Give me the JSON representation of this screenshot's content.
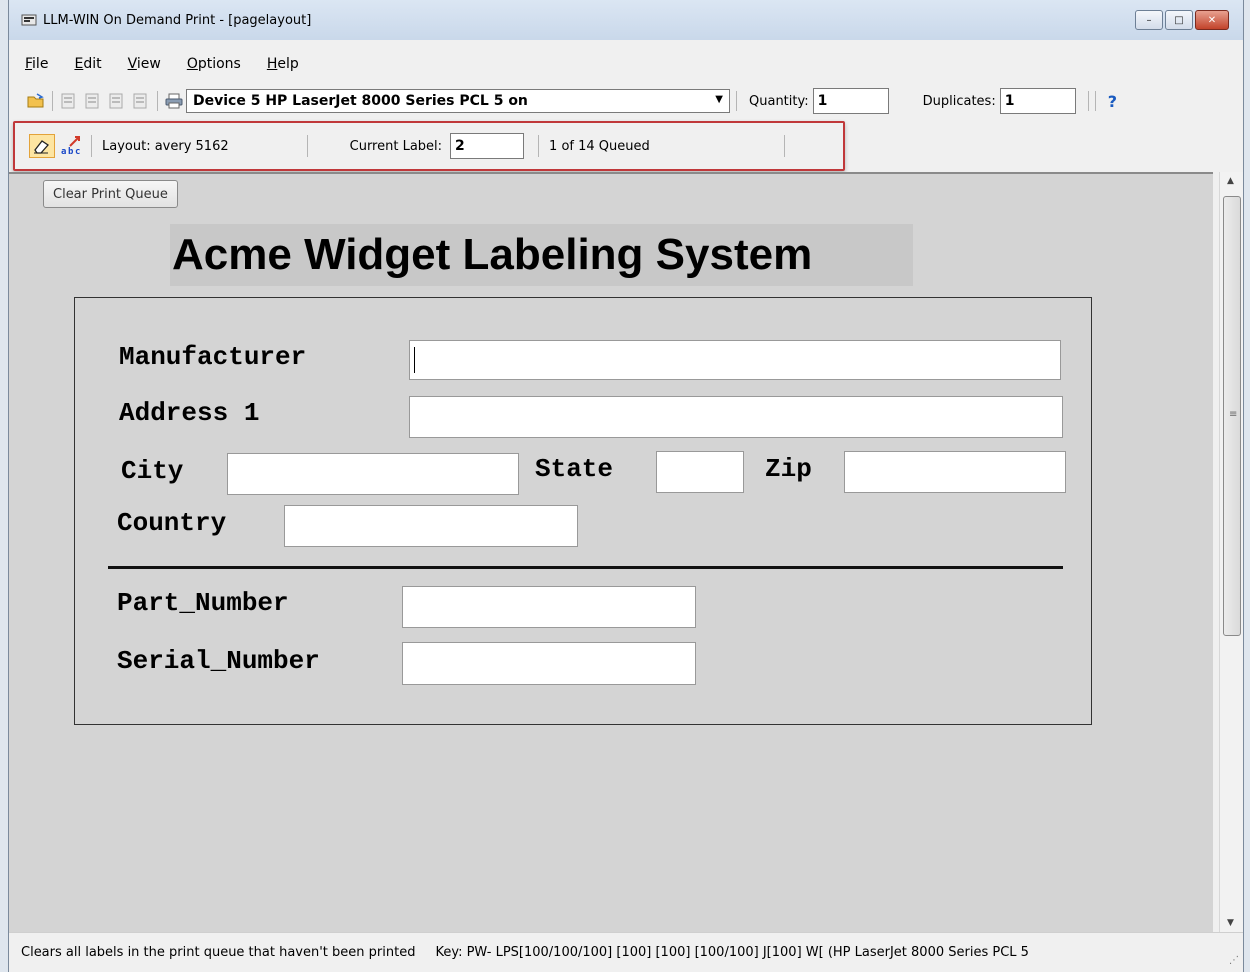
{
  "window": {
    "title": "LLM-WIN On Demand Print - [pagelayout]",
    "minimize_label": "–",
    "maximize_label": "□",
    "close_label": "✕"
  },
  "menu": {
    "items": [
      {
        "label": "File",
        "accel": "F",
        "rest": "ile"
      },
      {
        "label": "Edit",
        "accel": "E",
        "rest": "dit"
      },
      {
        "label": "View",
        "accel": "V",
        "rest": "iew"
      },
      {
        "label": "Options",
        "accel": "O",
        "rest": "ptions"
      },
      {
        "label": "Help",
        "accel": "H",
        "rest": "elp"
      }
    ]
  },
  "toolbar": {
    "printer_selected": "Device 5 HP LaserJet 8000 Series PCL 5 on",
    "quantity_label": "Quantity:",
    "quantity_value": "1",
    "duplicates_label": "Duplicates:",
    "duplicates_value": "1",
    "help_label": "?"
  },
  "label_toolbar": {
    "layout_text": "Layout:  avery 5162",
    "current_label_label": "Current Label:",
    "current_label_value": "2",
    "queue_status": "1 of 14 Queued"
  },
  "canvas": {
    "clear_button": "Clear Print Queue",
    "heading": "Acme Widget Labeling System",
    "fields": {
      "manufacturer_label": "Manufacturer",
      "address_label": "Address 1",
      "city_label": "City",
      "state_label": "State",
      "zip_label": "Zip",
      "country_label": "Country",
      "part_number_label": "Part_Number",
      "serial_number_label": "Serial_Number"
    }
  },
  "status": {
    "message": "Clears all labels in the print queue that haven't been printed",
    "key_info": "Key: PW- LPS[100/100/100] [100] [100] [100/100] J[100] W[  (HP LaserJet 8000 Series PCL 5"
  },
  "colors": {
    "highlight_border": "#c0383a",
    "canvas_bg": "#d4d4d4",
    "eraser_bg": "#fde5a2"
  }
}
